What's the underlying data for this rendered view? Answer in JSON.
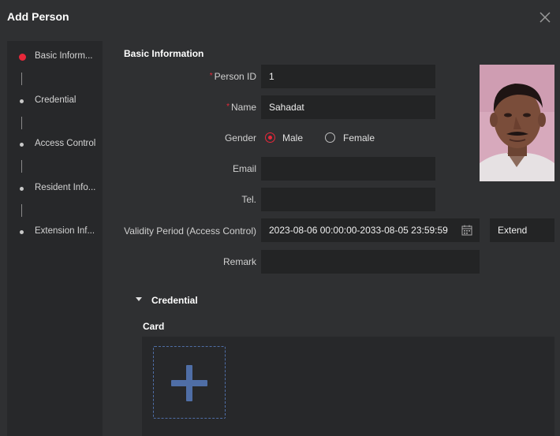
{
  "dialog": {
    "title": "Add Person",
    "close_icon": "close-icon"
  },
  "sidebar": {
    "items": [
      {
        "label": "Basic Inform...",
        "active": true
      },
      {
        "label": "Credential",
        "active": false
      },
      {
        "label": "Access Control",
        "active": false
      },
      {
        "label": "Resident Info...",
        "active": false
      },
      {
        "label": "Extension Inf...",
        "active": false
      }
    ]
  },
  "basic": {
    "section_title": "Basic Information",
    "person_id_label": "Person ID",
    "person_id_value": "1",
    "name_label": "Name",
    "name_value": "Sahadat",
    "gender_label": "Gender",
    "gender_options": [
      "Male",
      "Female"
    ],
    "gender_selected": "Male",
    "email_label": "Email",
    "email_value": "",
    "tel_label": "Tel.",
    "tel_value": "",
    "validity_label": "Validity Period (Access Control)",
    "validity_value": "2023-08-06 00:00:00-2033-08-05 23:59:59",
    "extend_label": "Extend",
    "remark_label": "Remark",
    "remark_value": "",
    "required_mark": "*"
  },
  "credential": {
    "section_title": "Credential",
    "card_label": "Card"
  },
  "colors": {
    "accent": "#e8283a",
    "add_icon": "#4f6ea6"
  }
}
